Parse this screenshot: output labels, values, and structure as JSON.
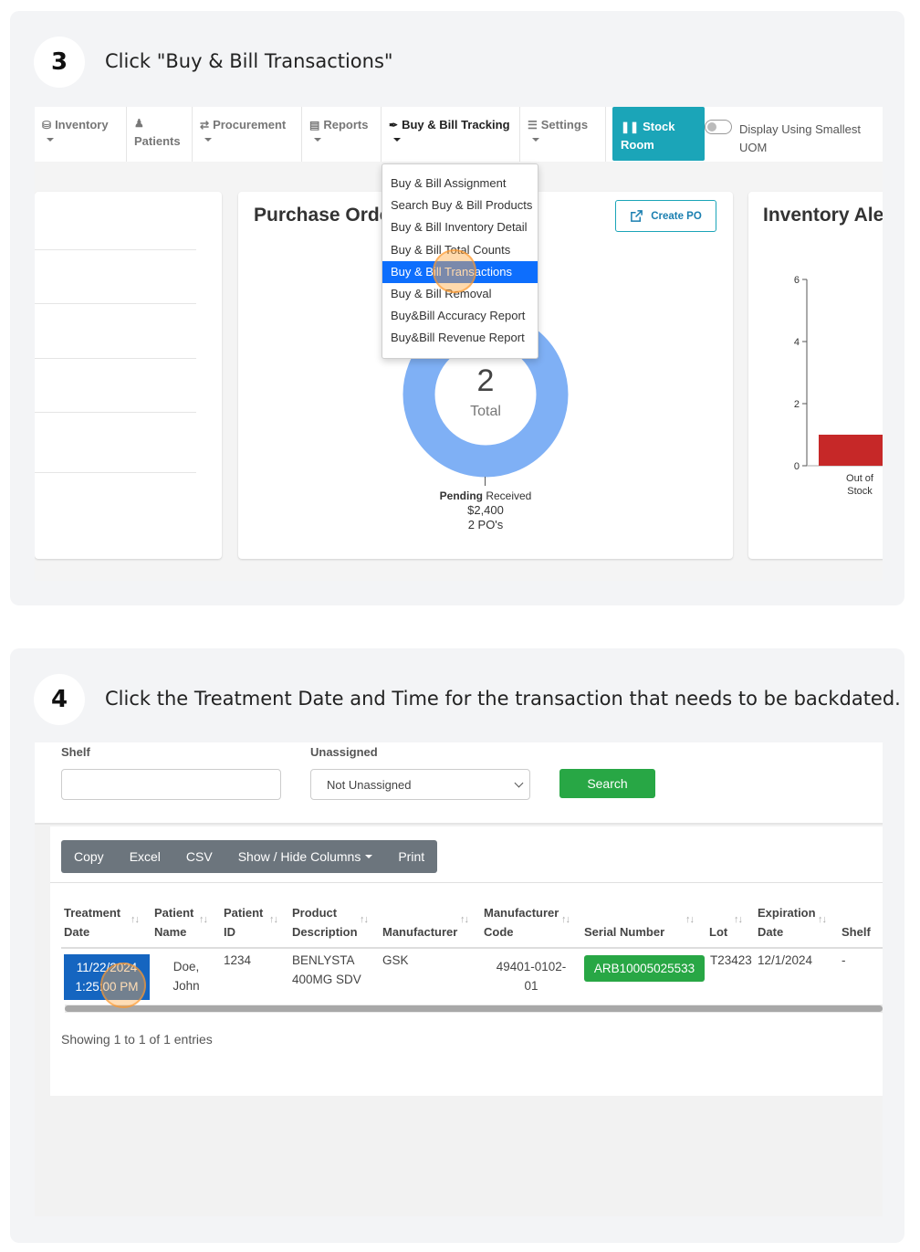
{
  "step3": {
    "number": "3",
    "instruction": "Click \"Buy & Bill Transactions\"",
    "nav": {
      "inventory": "Inventory",
      "patients": "Patients",
      "procurement": "Procurement",
      "reports": "Reports",
      "buy_bill_tracking": "Buy & Bill Tracking",
      "settings": "Settings",
      "stock_room_line1": "Stock",
      "stock_room_line2": "Room",
      "display_toggle_line1": "Display Using Smallest",
      "display_toggle_line2": "UOM"
    },
    "dropdown": {
      "items": [
        "Buy & Bill Assignment",
        "Search Buy & Bill Products",
        "Buy & Bill Inventory Detail",
        "Buy & Bill Total Counts",
        "Buy & Bill Transactions",
        "Buy & Bill Removal",
        "Buy&Bill Accuracy Report",
        "Buy&Bill Revenue Report"
      ],
      "selected_index": 4
    },
    "purchase_orders": {
      "title": "Purchase Orders",
      "create_label": "Create PO",
      "total_value": "2",
      "total_label": "Total",
      "legend_pending": "Pending",
      "legend_received": "Received",
      "amount": "$2,400",
      "count": "2 PO's",
      "donut_color": "#7fb0f5"
    },
    "inventory_alert": {
      "title": "Inventory Alerts",
      "chart_data": {
        "type": "bar",
        "categories": [
          "Out of Stock"
        ],
        "values": [
          1
        ],
        "ylim": [
          0,
          6
        ],
        "yticks": [
          "0",
          "2",
          "4",
          "6"
        ],
        "bar_color": "#c62828"
      }
    }
  },
  "step4": {
    "number": "4",
    "instruction": "Click the Treatment Date and Time for the transaction that needs to be backdated.",
    "filters": {
      "shelf_label": "Shelf",
      "shelf_value": "",
      "unassigned_label": "Unassigned",
      "unassigned_value": "Not Unassigned",
      "search_label": "Search"
    },
    "toolbar": [
      "Copy",
      "Excel",
      "CSV",
      "Show / Hide Columns",
      "Print"
    ],
    "table": {
      "columns": [
        [
          "Treatment",
          "Date"
        ],
        [
          "Patient",
          "Name"
        ],
        [
          "Patient",
          "ID"
        ],
        [
          "Product",
          "Description"
        ],
        [
          "",
          "Manufacturer"
        ],
        [
          "Manufacturer",
          "Code"
        ],
        [
          "",
          "Serial Number"
        ],
        [
          "",
          "Lot"
        ],
        [
          "Expiration",
          "Date"
        ],
        [
          "",
          "Shelf"
        ]
      ],
      "row": {
        "date_line1": "11/22/2024",
        "date_line2": "1:25:00 PM",
        "name_line1": "Doe,",
        "name_line2": "John",
        "patient_id": "1234",
        "product_line1": "BENLYSTA",
        "product_line2": "400MG SDV",
        "manufacturer": "GSK",
        "code_line1": "49401-0102-",
        "code_line2": "01",
        "serial": "ARB10005025533",
        "lot": "T23423",
        "expiration": "12/1/2024",
        "shelf": "-"
      }
    },
    "footer": "Showing 1 to 1 of 1 entries"
  }
}
